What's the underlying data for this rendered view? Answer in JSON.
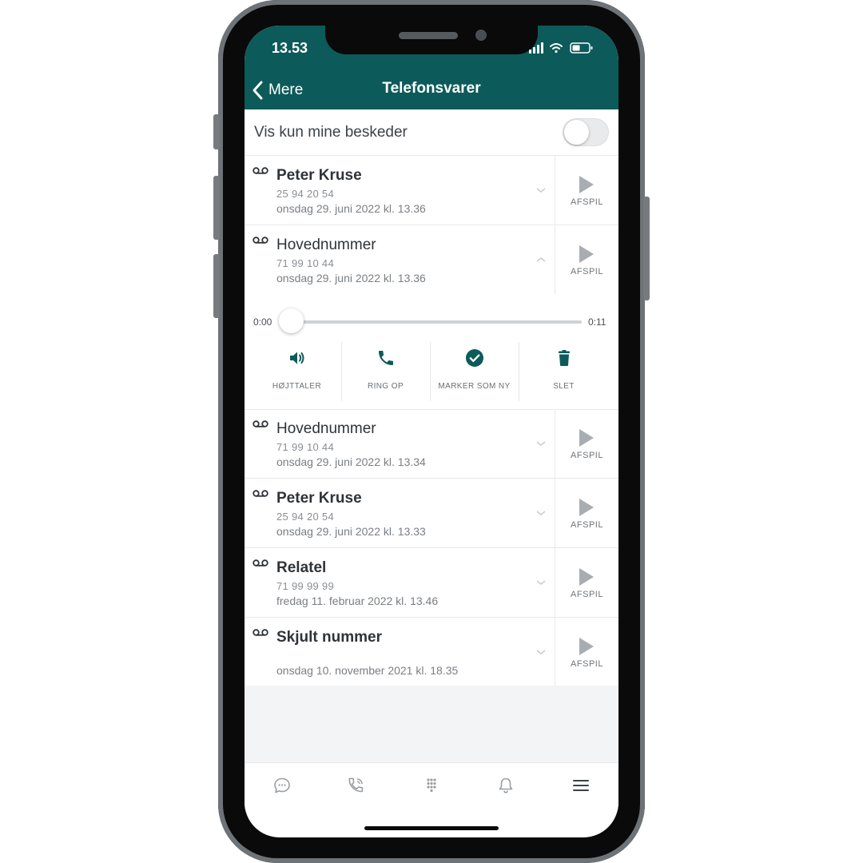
{
  "status_bar": {
    "time": "13.53"
  },
  "nav": {
    "back_label": "Mere",
    "title": "Telefonsvarer"
  },
  "filter": {
    "label": "Vis kun mine beskeder",
    "enabled": false
  },
  "voicemails": [
    {
      "name": "Peter Kruse",
      "unread": true,
      "number": "25 94 20 54",
      "date": "onsdag 29. juni 2022 kl. 13.36",
      "play_label": "AFSPIL",
      "expanded": false
    },
    {
      "name": "Hovednummer",
      "unread": false,
      "number": "71 99 10 44",
      "date": "onsdag 29. juni 2022 kl. 13.36",
      "play_label": "AFSPIL",
      "expanded": true
    },
    {
      "name": "Hovednummer",
      "unread": false,
      "number": "71 99 10 44",
      "date": "onsdag 29. juni 2022 kl. 13.34",
      "play_label": "AFSPIL",
      "expanded": false
    },
    {
      "name": "Peter Kruse",
      "unread": true,
      "number": "25 94 20 54",
      "date": "onsdag 29. juni 2022 kl. 13.33",
      "play_label": "AFSPIL",
      "expanded": false
    },
    {
      "name": "Relatel",
      "unread": true,
      "number": "71 99 99 99",
      "date": "fredag 11. februar 2022 kl. 13.46",
      "play_label": "AFSPIL",
      "expanded": false
    },
    {
      "name": "Skjult nummer",
      "unread": true,
      "number": "",
      "date": "onsdag 10. november 2021 kl. 18.35",
      "play_label": "AFSPIL",
      "expanded": false
    }
  ],
  "player": {
    "current_time": "0:00",
    "duration": "0:11",
    "progress": 0,
    "actions": [
      {
        "label": "HØJTTALER",
        "icon": "speaker-icon"
      },
      {
        "label": "RING OP",
        "icon": "phone-icon"
      },
      {
        "label": "MARKER SOM NY",
        "icon": "check-circle-icon"
      },
      {
        "label": "SLET",
        "icon": "trash-icon"
      }
    ]
  },
  "tabbar": {
    "tabs": [
      "chat-icon",
      "call-history-icon",
      "dialpad-icon",
      "bell-icon",
      "menu-icon"
    ],
    "active": "menu-icon"
  },
  "colors": {
    "header": "#0d5a5a",
    "accent": "#0d5a5a",
    "background": "#f3f4f6"
  }
}
